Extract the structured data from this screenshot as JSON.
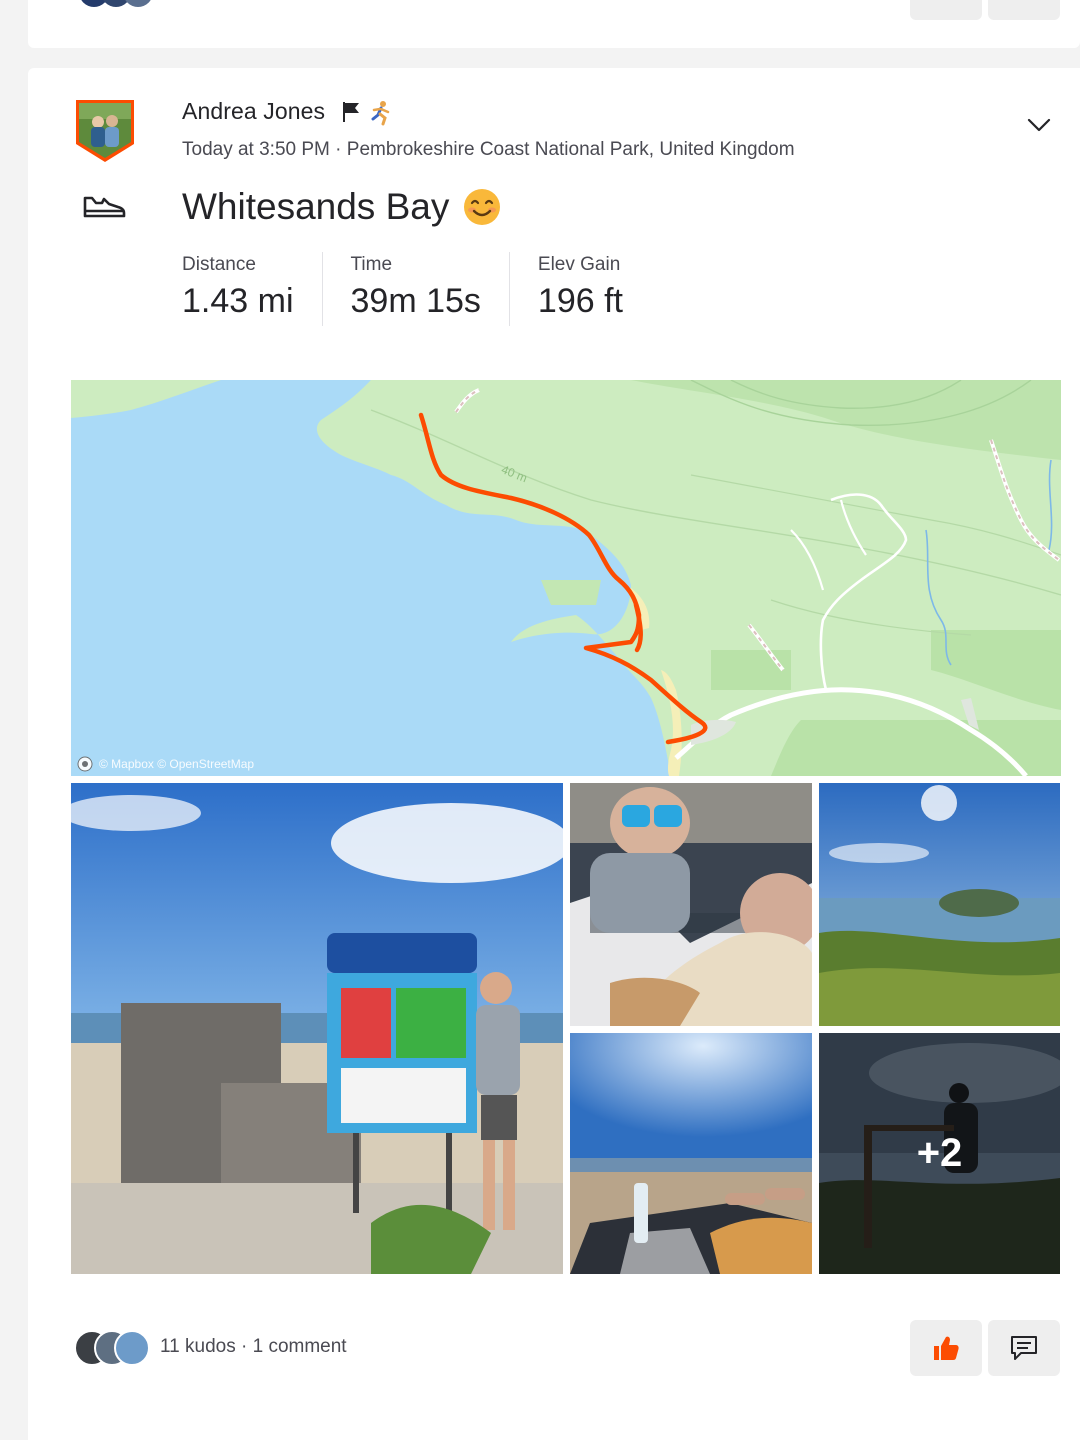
{
  "activity": {
    "athlete_name": "Andrea Jones",
    "timestamp": "Today at 3:50 PM",
    "separator": " · ",
    "location": "Pembrokeshire Coast National Park, United Kingdom",
    "title": "Whitesands Bay",
    "title_emoji": "smiling-face-icon",
    "sport_icon": "shoe-icon",
    "stats": [
      {
        "label": "Distance",
        "value": "1.43 mi"
      },
      {
        "label": "Time",
        "value": "39m 15s"
      },
      {
        "label": "Elev Gain",
        "value": "196 ft"
      }
    ]
  },
  "map": {
    "attribution": "© Mapbox © OpenStreetMap",
    "contour_label": "40 m",
    "route_color": "#fc4c02"
  },
  "photos": {
    "more_count": "+2"
  },
  "social": {
    "kudos_text": "11 kudos",
    "separator": " · ",
    "comments_text": "1 comment"
  },
  "colors": {
    "accent": "#fc4c02",
    "water": "#aadaf7",
    "land": "#cdecc0"
  }
}
